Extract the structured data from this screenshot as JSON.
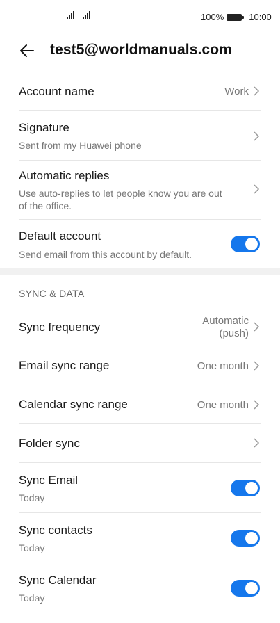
{
  "status_bar": {
    "battery": "100%",
    "time": "10:00"
  },
  "header": {
    "title": "test5@worldmanuals.com",
    "back_icon": "arrow-left-icon"
  },
  "account": {
    "account_name": {
      "label": "Account name",
      "value": "Work"
    },
    "signature": {
      "label": "Signature",
      "subtitle": "Sent from my Huawei phone"
    },
    "automatic_replies": {
      "label": "Automatic replies",
      "subtitle_line1": "Use auto-replies to let people know you are out",
      "subtitle_line2": "of the office."
    },
    "default_account": {
      "label": "Default account",
      "subtitle": "Send email from this account by default.",
      "enabled": true
    }
  },
  "sync": {
    "section_title": "SYNC & DATA",
    "sync_frequency": {
      "label": "Sync frequency",
      "value_line1": "Automatic",
      "value_line2": "(push)"
    },
    "email_sync_range": {
      "label": "Email sync range",
      "value": "One month"
    },
    "calendar_sync_range": {
      "label": "Calendar sync range",
      "value": "One month"
    },
    "folder_sync": {
      "label": "Folder sync"
    },
    "sync_email": {
      "label": "Sync Email",
      "subtitle": "Today",
      "enabled": true
    },
    "sync_contacts": {
      "label": "Sync contacts",
      "subtitle": "Today",
      "enabled": true
    },
    "sync_calendar": {
      "label": "Sync Calendar",
      "subtitle": "Today",
      "enabled": true
    }
  },
  "colors": {
    "toggle_on": "#1577ec",
    "divider": "#e6e6e6",
    "section_gap": "#f1f1f1"
  }
}
